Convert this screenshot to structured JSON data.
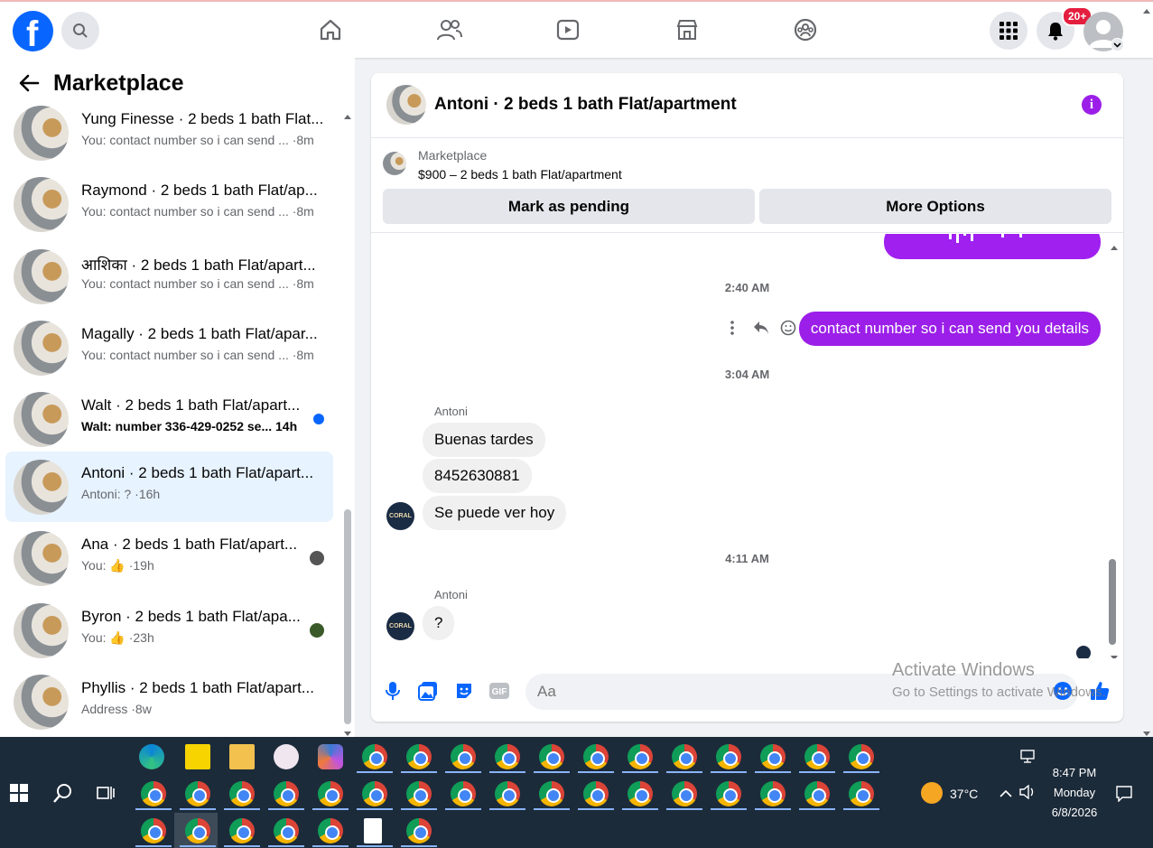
{
  "topbar": {
    "logo_letter": "f",
    "notifications_badge": "20+"
  },
  "sidebar": {
    "title": "Marketplace",
    "conversations": [
      {
        "name": "Yung Finesse · 2 beds 1 bath Flat...",
        "preview": "You: contact number so i can send ... ·8m",
        "unread": false
      },
      {
        "name": "Raymond · 2 beds 1 bath Flat/ap...",
        "preview": "You: contact number so i can send ... ·8m",
        "unread": false
      },
      {
        "name": "आशिका · 2 beds 1 bath Flat/apart...",
        "preview": "You: contact number so i can send ... ·8m",
        "unread": false
      },
      {
        "name": "Magally · 2 beds 1 bath Flat/apar...",
        "preview": "You: contact number so i can send ... ·8m",
        "unread": false
      },
      {
        "name": "Walt · 2 beds 1 bath Flat/apart...",
        "preview": "Walt: number 336-429-0252 se... 14h",
        "unread": true
      },
      {
        "name": "Antoni · 2 beds 1 bath Flat/apart...",
        "preview": "Antoni: ? ·16h",
        "unread": false,
        "active": true
      },
      {
        "name": "Ana · 2 beds 1 bath Flat/apart...",
        "preview": "You: 👍 ·19h",
        "unread": false
      },
      {
        "name": "Byron · 2 beds 1 bath Flat/apa...",
        "preview": "You: 👍 ·23h",
        "unread": false
      },
      {
        "name": "Phyllis · 2 beds 1 bath Flat/apart...",
        "preview": "Address ·8w",
        "unread": false
      }
    ]
  },
  "chat": {
    "title": "Antoni · 2 beds 1 bath Flat/apartment",
    "listing_source": "Marketplace",
    "listing_price": "$900 – 2 beds 1 bath Flat/apartment",
    "mark_pending_label": "Mark as pending",
    "more_options_label": "More Options",
    "timestamps": [
      "2:40 AM",
      "3:04 AM",
      "4:11 AM"
    ],
    "my_message": "contact number so i can send you details",
    "sender_name": "Antoni",
    "their_messages_1": [
      "Buenas tardes",
      "8452630881",
      "Se puede ver hoy"
    ],
    "their_messages_2": [
      "?"
    ],
    "avatar_text": "CORAL",
    "composer_placeholder": "Aa"
  },
  "watermark": {
    "line1": "Activate Windows",
    "line2": "Go to Settings to activate Windows."
  },
  "taskbar": {
    "weather": "37°C",
    "time": "8:47 PM",
    "day": "Monday",
    "date": "6/8/2026"
  },
  "colors": {
    "facebook_blue": "#0866ff",
    "messenger_purple": "#9b1fe8",
    "taskbar_bg": "#1c2b3a"
  }
}
